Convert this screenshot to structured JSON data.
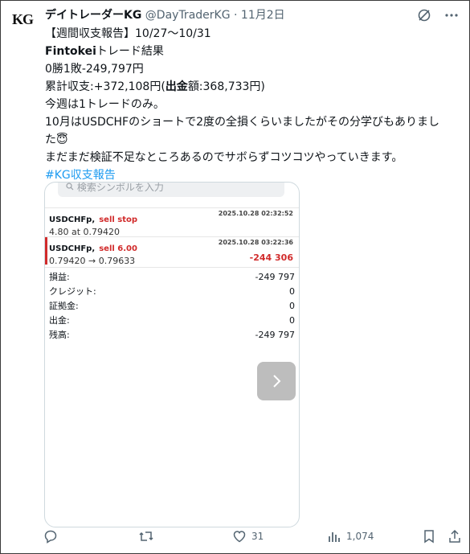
{
  "author": {
    "avatar_text": "KG",
    "display_name": "デイトレーダーKG",
    "handle": "@DayTraderKG",
    "separator": "·",
    "date": "11月2日"
  },
  "post": {
    "line1": "【週間収支報告】10/27〜10/31",
    "line2_bold": "Fintokei",
    "line2_rest": "トレード結果",
    "line3": "0勝1敗-249,797円",
    "line4_a": "累計収支:+372,108円(",
    "line4_bold": "出金",
    "line4_b": "額:368,733円)",
    "line5": "今週は1トレードのみ。",
    "line6": "10月はUSDCHFのショートで2度の全損くらいましたがその分学びもありまし",
    "line7": "た😇",
    "line8": "まだまだ検証不足なところあるのでサボらずコツコツやっていきます。",
    "hashtag": "#KG収支報告"
  },
  "card": {
    "search_placeholder": "検索シンボルを入力",
    "order1": {
      "symbol": "USDCHFp,",
      "type": "sell stop",
      "timestamp": "2025.10.28 02:32:52",
      "detail": "4.80 at 0.79420"
    },
    "order2": {
      "symbol": "USDCHFp,",
      "type": "sell 6.00",
      "timestamp": "2025.10.28 03:22:36",
      "detail": "0.79420 → 0.79633",
      "pl": "-244 306"
    },
    "summary": [
      {
        "label": "損益:",
        "value": "-249 797"
      },
      {
        "label": "クレジット:",
        "value": "0"
      },
      {
        "label": "証拠金:",
        "value": "0"
      },
      {
        "label": "出金:",
        "value": "0"
      },
      {
        "label": "残高:",
        "value": "-249 797"
      }
    ]
  },
  "actions": {
    "reply": "",
    "retweet": "",
    "likes": "31",
    "views": "1,074"
  },
  "colors": {
    "link": "#1d9bf0",
    "muted": "#536471",
    "loss_red": "#d12b2b"
  }
}
